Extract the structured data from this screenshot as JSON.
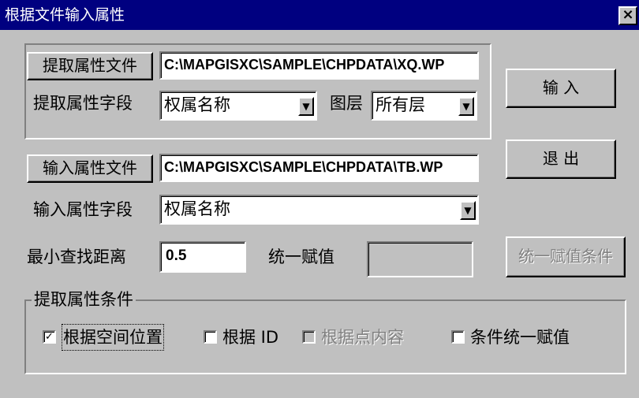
{
  "window": {
    "title": "根据文件输入属性",
    "close": "×"
  },
  "extract": {
    "file_button": "提取属性文件",
    "file_path": "C:\\MAPGISXC\\SAMPLE\\CHPDATA\\XQ.WP",
    "field_label": "提取属性字段",
    "field_value": "权属名称",
    "layer_label": "图层",
    "layer_value": "所有层"
  },
  "input": {
    "file_button": "输入属性文件",
    "file_path": "C:\\MAPGISXC\\SAMPLE\\CHPDATA\\TB.WP",
    "field_label": "输入属性字段",
    "field_value": "权属名称"
  },
  "min_distance": {
    "label": "最小查找距离",
    "value": "0.5"
  },
  "unify": {
    "label": "统一赋值",
    "value": ""
  },
  "buttons": {
    "ok": "输 入",
    "exit": "退 出",
    "unify_condition": "统一赋值条件"
  },
  "conditions": {
    "group_label": "提取属性条件",
    "items": [
      {
        "label": "根据空间位置",
        "checked": true,
        "enabled": true
      },
      {
        "label": "根据 ID",
        "checked": false,
        "enabled": true
      },
      {
        "label": "根据点内容",
        "checked": false,
        "enabled": false
      },
      {
        "label": "条件统一赋值",
        "checked": false,
        "enabled": true
      }
    ]
  },
  "icons": {
    "dropdown": "▼",
    "check": "✓"
  }
}
